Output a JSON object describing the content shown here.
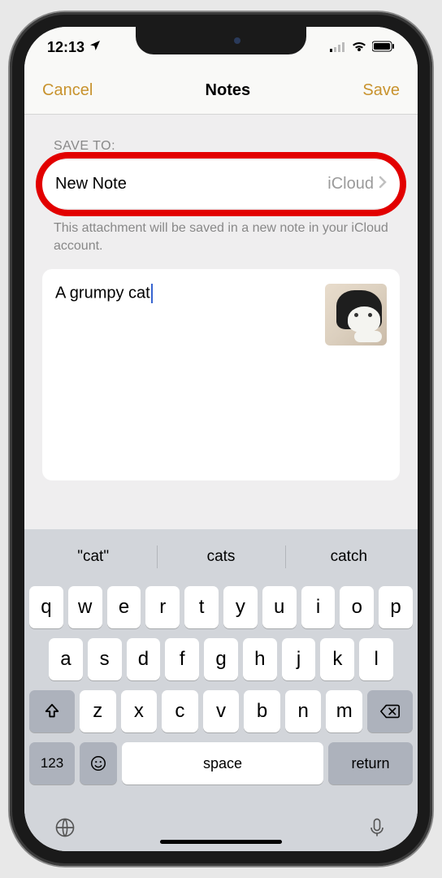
{
  "status": {
    "time": "12:13",
    "location_icon": "location-arrow"
  },
  "nav": {
    "cancel": "Cancel",
    "title": "Notes",
    "save": "Save"
  },
  "section": {
    "label": "SAVE TO:",
    "destination_title": "New Note",
    "destination_account": "iCloud",
    "subtitle": "This attachment will be saved in a new note in your iCloud account."
  },
  "note": {
    "text": "A grumpy cat",
    "thumb_alt": "grumpy cat photo"
  },
  "keyboard": {
    "suggestions": [
      "\"cat\"",
      "cats",
      "catch"
    ],
    "row1": [
      "q",
      "w",
      "e",
      "r",
      "t",
      "y",
      "u",
      "i",
      "o",
      "p"
    ],
    "row2": [
      "a",
      "s",
      "d",
      "f",
      "g",
      "h",
      "j",
      "k",
      "l"
    ],
    "row3": [
      "z",
      "x",
      "c",
      "v",
      "b",
      "n",
      "m"
    ],
    "numkey": "123",
    "space": "space",
    "return": "return"
  }
}
